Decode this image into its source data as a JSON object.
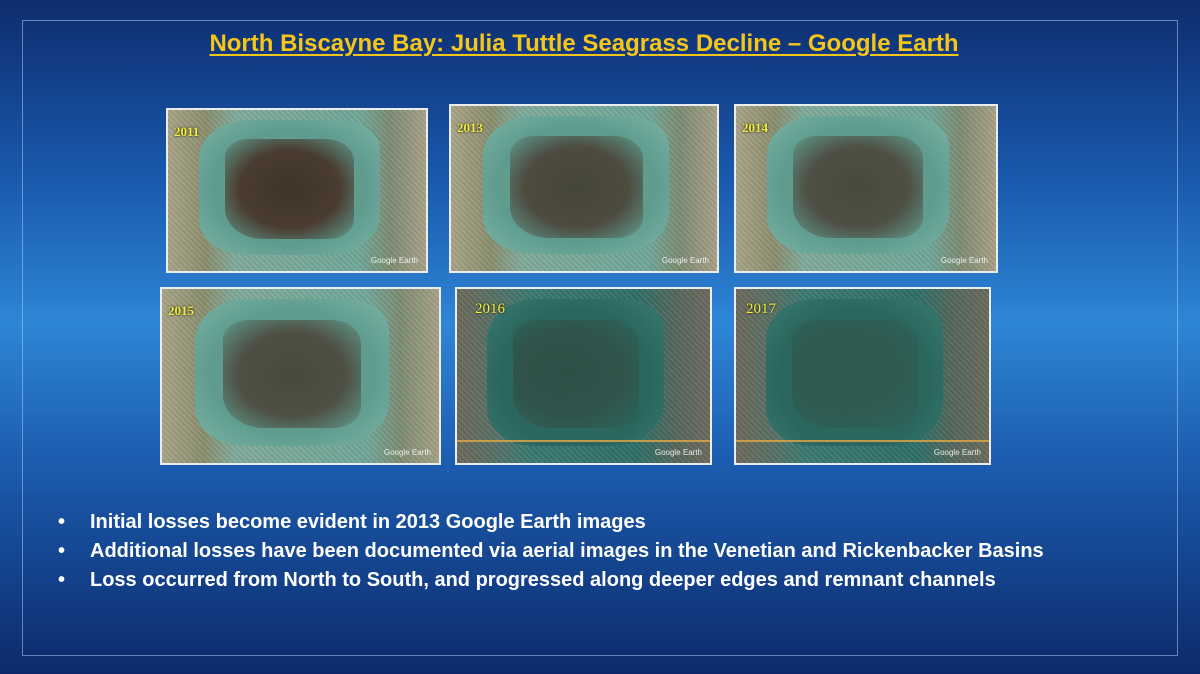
{
  "slide": {
    "title": "North Biscayne Bay: Julia Tuttle Seagrass Decline – Google Earth"
  },
  "images": [
    {
      "year": "2011",
      "watermark": "Google Earth",
      "style": "light"
    },
    {
      "year": "2013",
      "watermark": "Google Earth",
      "style": "light"
    },
    {
      "year": "2014",
      "watermark": "Google Earth",
      "style": "light"
    },
    {
      "year": "2015",
      "watermark": "Google Earth",
      "style": "light"
    },
    {
      "year": "2016",
      "watermark": "Google Earth",
      "style": "dark"
    },
    {
      "year": "2017",
      "watermark": "Google Earth",
      "style": "dark"
    }
  ],
  "bullets": [
    "Initial losses become evident in 2013 Google Earth images",
    "Additional losses have been documented via aerial images in the Venetian and Rickenbacker Basins",
    "Loss occurred from North to South, and progressed along deeper edges and remnant channels"
  ],
  "bullet_symbol": "•",
  "colors": {
    "title": "#f5c518",
    "year_label": "#f4ef3a",
    "bullet_text": "#ffffff",
    "background_center": "#2f86d6",
    "background_edge": "#0c2a6b"
  }
}
